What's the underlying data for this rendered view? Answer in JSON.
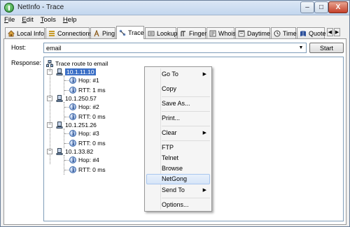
{
  "window": {
    "title": "NetInfo - Trace"
  },
  "title_buttons": {
    "minimize": "–",
    "maximize": "□",
    "close": "X"
  },
  "menu": [
    {
      "label": "File",
      "hotkey": "F",
      "rest": "ile"
    },
    {
      "label": "Edit",
      "hotkey": "E",
      "rest": "dit"
    },
    {
      "label": "Tools",
      "hotkey": "T",
      "rest": "ools"
    },
    {
      "label": "Help",
      "hotkey": "H",
      "rest": "elp"
    }
  ],
  "tabs": [
    {
      "label": "Local Info",
      "icon": "house-icon"
    },
    {
      "label": "Connections",
      "icon": "connections-icon"
    },
    {
      "label": "Ping",
      "icon": "ping-icon"
    },
    {
      "label": "Trace",
      "icon": "trace-icon",
      "active": true
    },
    {
      "label": "Lookup",
      "icon": "lookup-icon"
    },
    {
      "label": "Finger",
      "icon": "finger-icon"
    },
    {
      "label": "Whois",
      "icon": "whois-icon"
    },
    {
      "label": "Daytime",
      "icon": "daytime-icon"
    },
    {
      "label": "Time",
      "icon": "clock-icon"
    },
    {
      "label": "Quote",
      "icon": "quote-icon"
    }
  ],
  "tab_scroll": {
    "left": "◀",
    "right": "▶"
  },
  "form": {
    "host_label": "Host:",
    "host_value": "email",
    "start_label": "Start",
    "response_label": "Response:"
  },
  "tree": {
    "root": "Trace route to email",
    "hops": [
      {
        "ip": "10.1.11.10",
        "hop": "Hop: #1",
        "rtt": "RTT: 1 ms"
      },
      {
        "ip": "10.1.250.57",
        "hop": "Hop: #2",
        "rtt": "RTT: 0 ms"
      },
      {
        "ip": "10.1.251.26",
        "hop": "Hop: #3",
        "rtt": "RTT: 0 ms"
      },
      {
        "ip": "10.1.33.82",
        "hop": "Hop: #4",
        "rtt": "RTT: 0 ms"
      }
    ]
  },
  "context_menu": {
    "goto": "Go To",
    "copy": "Copy",
    "save_as": "Save As...",
    "print": "Print...",
    "clear": "Clear",
    "ftp": "FTP",
    "telnet": "Telnet",
    "browse": "Browse",
    "netgong": "NetGong",
    "send_to": "Send To",
    "options": "Options..."
  },
  "colors": {
    "selection": "#3b6fc6",
    "close_button": "#c5402a"
  }
}
